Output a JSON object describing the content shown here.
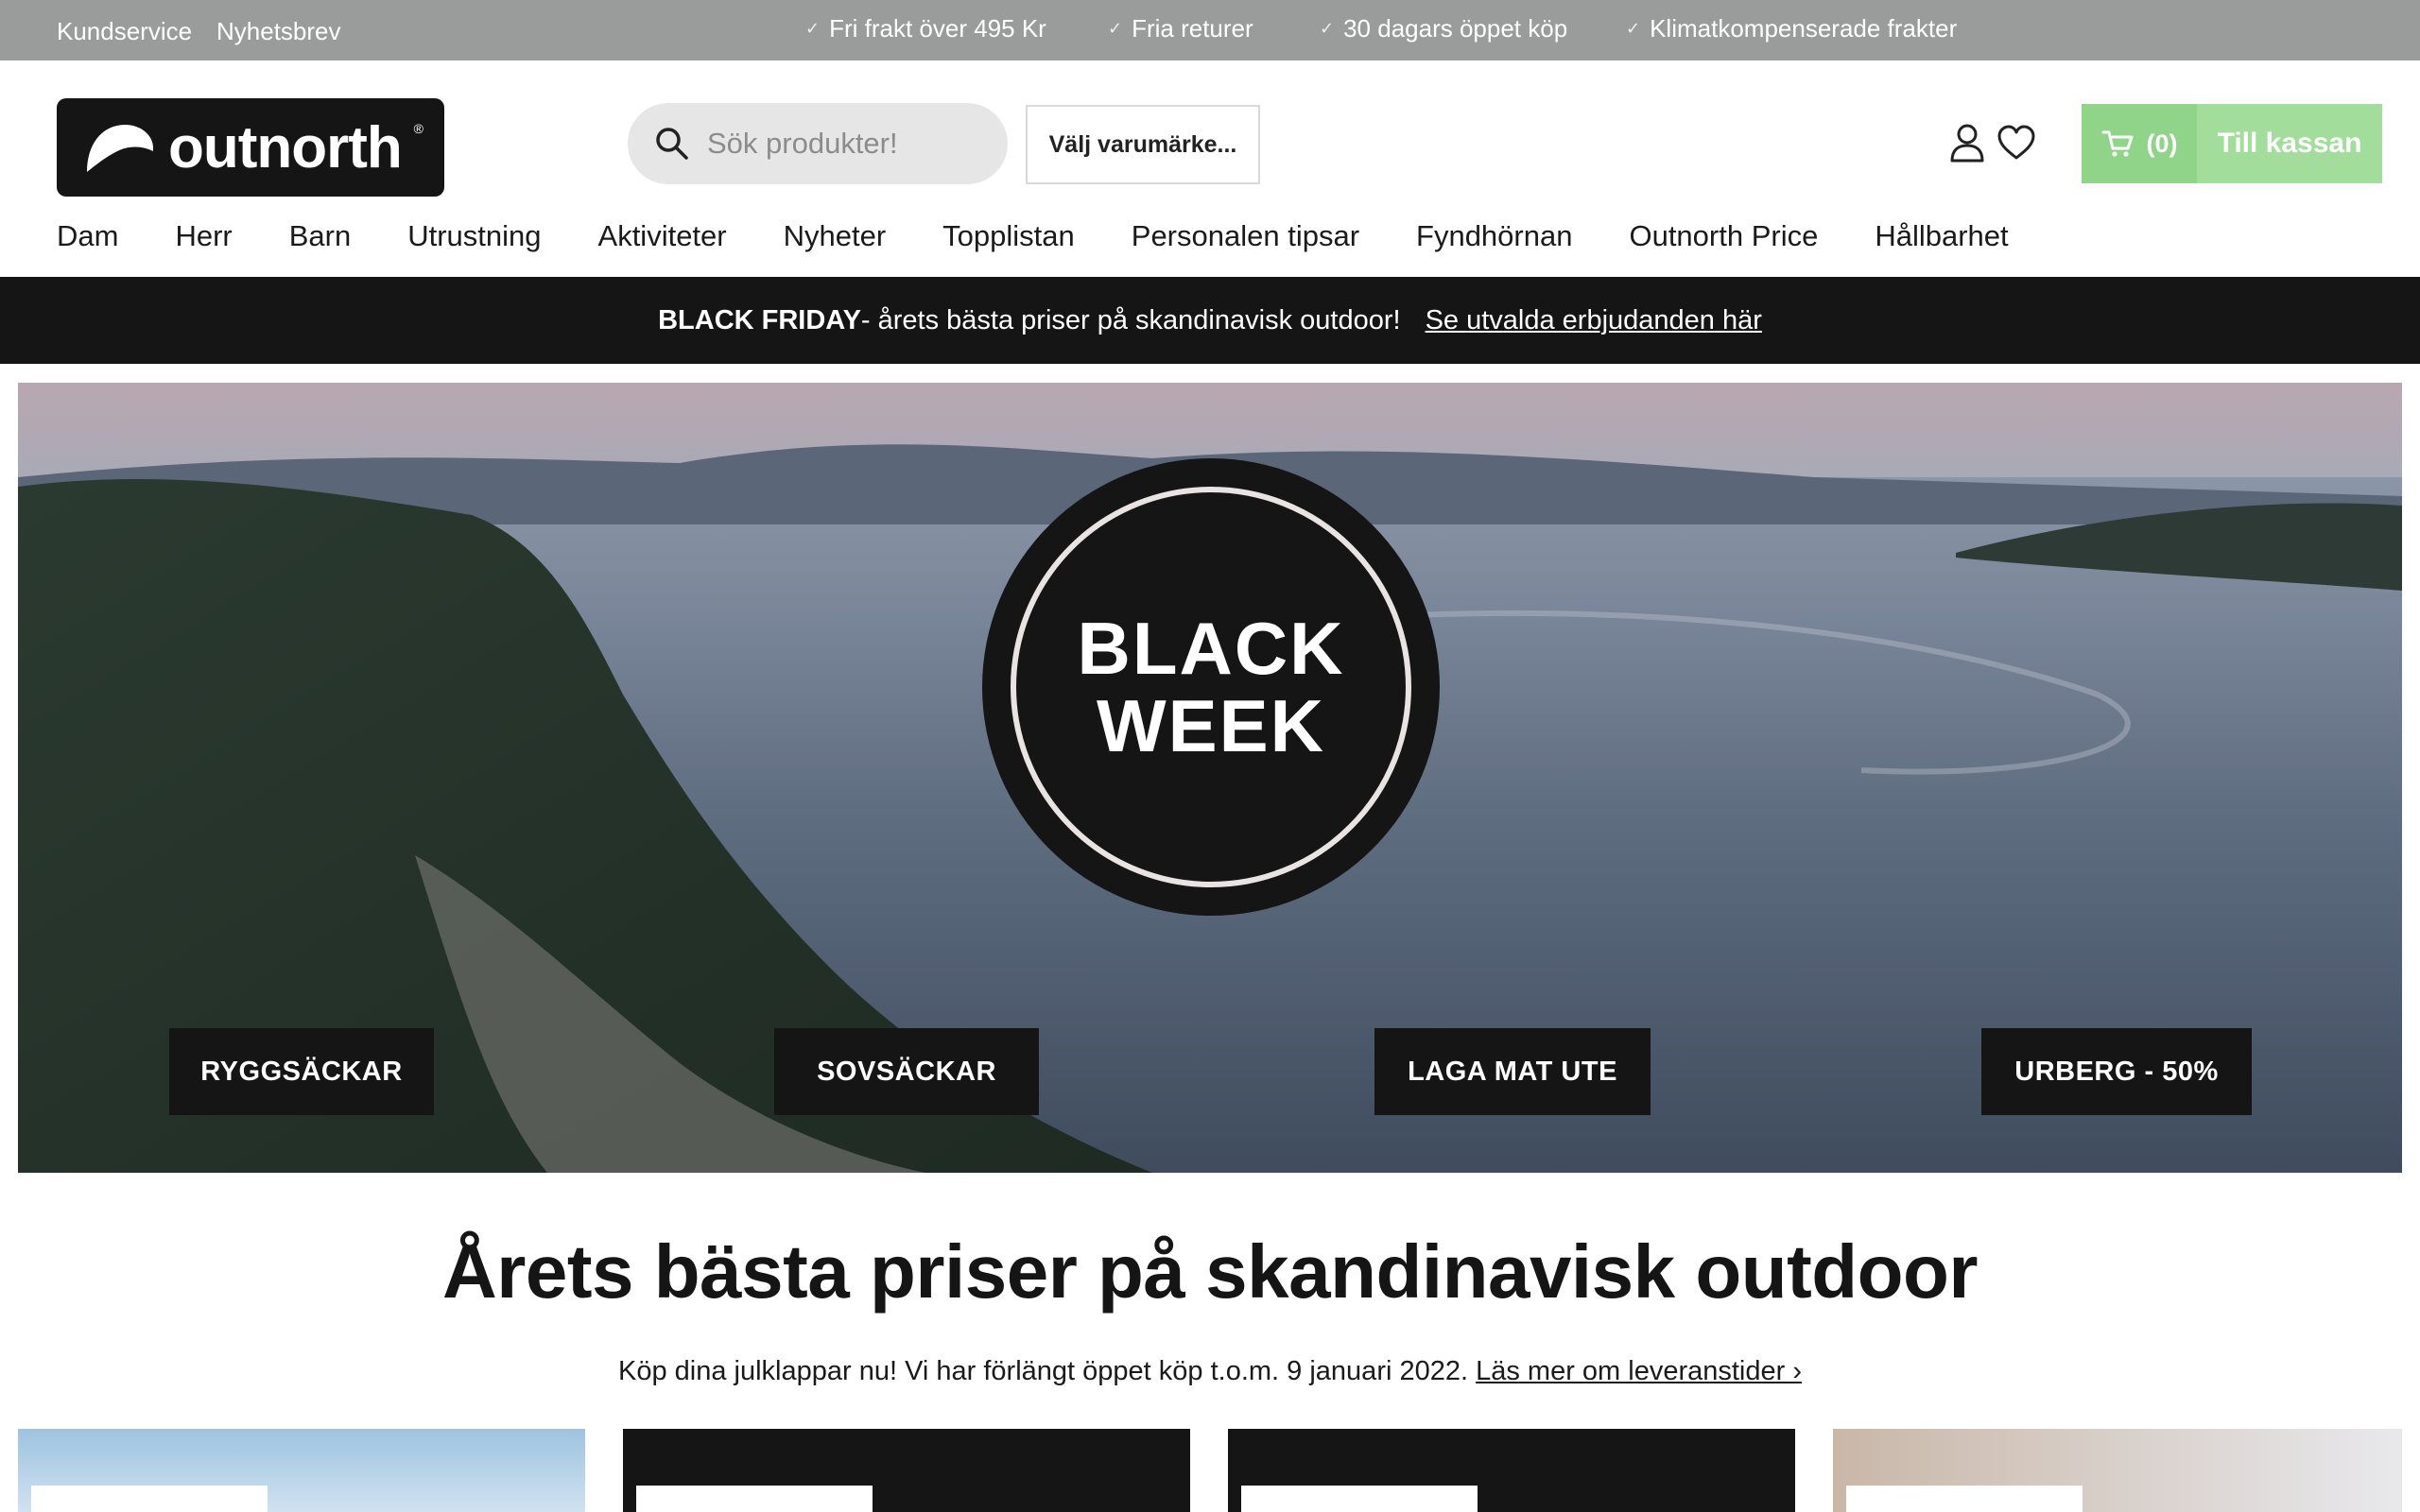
{
  "utility": {
    "links": [
      "Kundservice",
      "Nyhetsbrev"
    ],
    "usps": [
      "Fri frakt över 495 Kr",
      "Fria returer",
      "30 dagars öppet köp",
      "Klimatkompenserade frakter"
    ]
  },
  "header": {
    "logo_text": "outnorth",
    "search_placeholder": "Sök produkter!",
    "brand_select_label": "Välj varumärke...",
    "cart_count": "(0)",
    "checkout_label": "Till kassan"
  },
  "nav": {
    "items": [
      "Dam",
      "Herr",
      "Barn",
      "Utrustning",
      "Aktiviteter",
      "Nyheter",
      "Topplistan",
      "Personalen tipsar",
      "Fyndhörnan",
      "Outnorth Price",
      "Hållbarhet"
    ]
  },
  "promo": {
    "bold": "BLACK FRIDAY",
    "text": " - årets bästa priser på skandinavisk outdoor!",
    "link": "Se utvalda erbjudanden här"
  },
  "hero": {
    "badge_line1": "BLACK",
    "badge_line2": "WEEK",
    "categories": [
      "RYGGSÄCKAR",
      "SOVSÄCKAR",
      "LAGA MAT UTE",
      "URBERG - 50%"
    ]
  },
  "content": {
    "headline": "Årets bästa priser på skandinavisk outdoor",
    "subline_text": "Köp dina julklappar nu! Vi har förlängt öppet köp t.o.m. 9 januari 2022. ",
    "subline_link": "Läs mer om leveranstider ›"
  },
  "colors": {
    "utility_bg": "#9a9b9b",
    "cart_green": "#8fd488",
    "checkout_green": "#a3dd9c",
    "promo_bg": "#151515"
  }
}
